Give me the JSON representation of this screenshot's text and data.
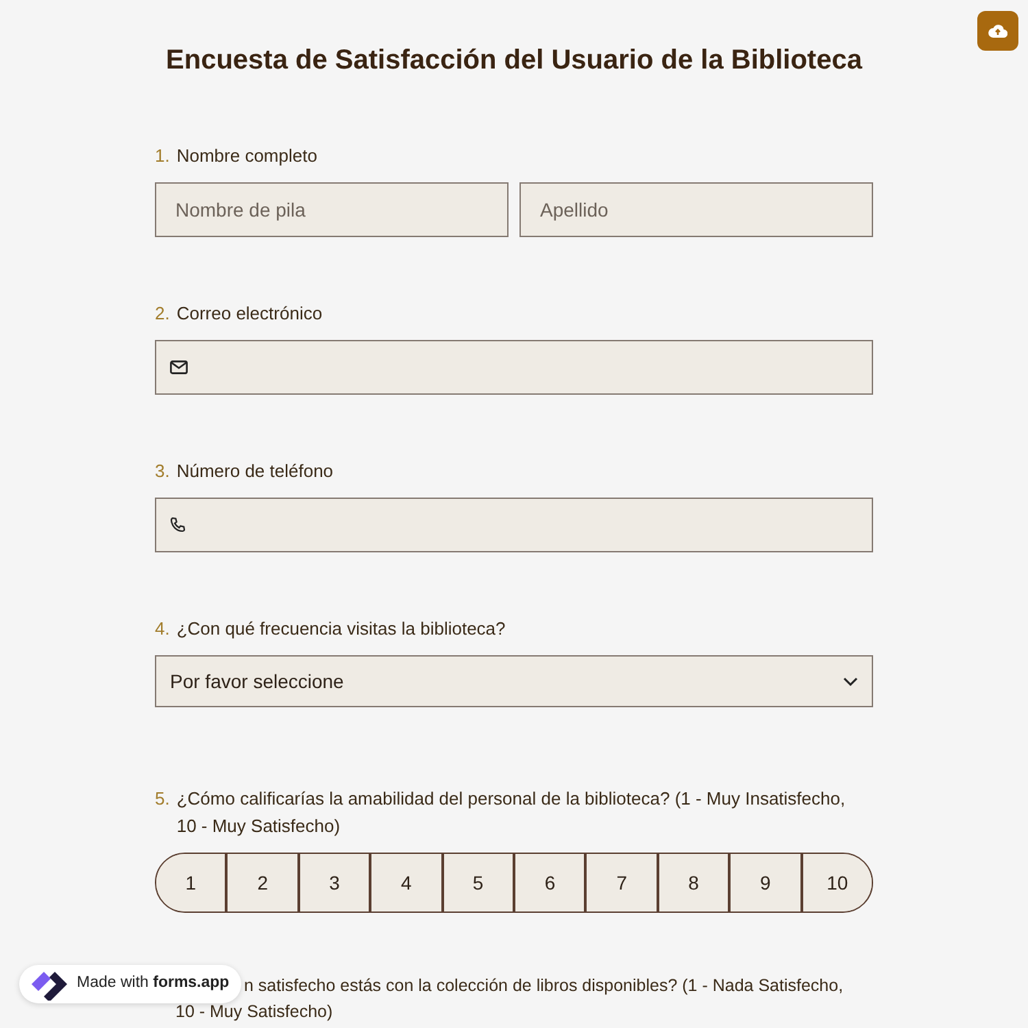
{
  "title": "Encuesta de Satisfacción del Usuario de la Biblioteca",
  "questions": [
    {
      "kind": "name",
      "number": "1.",
      "label": "Nombre completo",
      "fields": [
        {
          "placeholder": "Nombre de pila"
        },
        {
          "placeholder": "Apellido"
        }
      ]
    },
    {
      "kind": "email",
      "number": "2.",
      "label": "Correo electrónico"
    },
    {
      "kind": "phone",
      "number": "3.",
      "label": "Número de teléfono"
    },
    {
      "kind": "select",
      "number": "4.",
      "label": "¿Con qué frecuencia visitas la biblioteca?",
      "value": "Por favor seleccione"
    },
    {
      "kind": "rating",
      "number": "5.",
      "label": "¿Cómo calificarías la amabilidad del personal de la biblioteca? (1 - Muy Insatisfecho, 10 - Muy Satisfecho)",
      "options": [
        "1",
        "2",
        "3",
        "4",
        "5",
        "6",
        "7",
        "8",
        "9",
        "10"
      ]
    },
    {
      "kind": "rating",
      "label_lines": [
        "n satisfecho estás con la colección de libros disponibles? (1 - Nada Satisfecho,",
        "10 - Muy Satisfecho)"
      ]
    }
  ],
  "badge": {
    "prefix": "Made with",
    "brand": "forms.app"
  }
}
